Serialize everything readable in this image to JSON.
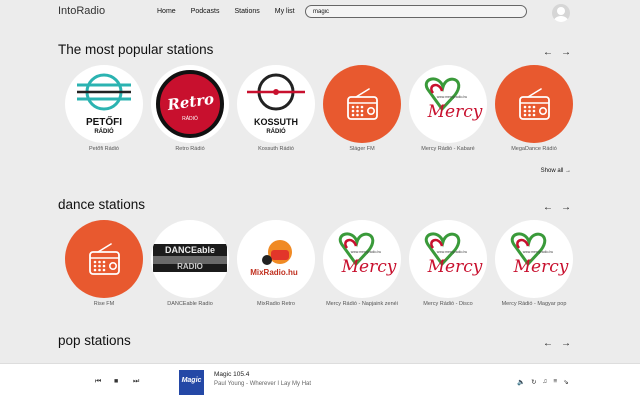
{
  "brand": "IntoRadio",
  "nav": [
    "Home",
    "Podcasts",
    "Stations",
    "My list"
  ],
  "search": {
    "value": "magic"
  },
  "sections": [
    {
      "title": "The most popular stations",
      "show_all": "Show all",
      "stations": [
        {
          "label": "Petőfi Rádió",
          "logo": "petofi"
        },
        {
          "label": "Retro Rádió",
          "logo": "retro"
        },
        {
          "label": "Kossuth Rádió",
          "logo": "kossuth"
        },
        {
          "label": "Sláger FM",
          "logo": "radio"
        },
        {
          "label": "Mercy Rádió - Kabaré",
          "logo": "mercy"
        },
        {
          "label": "MegaDance Rádió",
          "logo": "radio"
        }
      ]
    },
    {
      "title": "dance stations",
      "stations": [
        {
          "label": "Rise FM",
          "logo": "radio"
        },
        {
          "label": "DANCEable Radio",
          "logo": "danceable"
        },
        {
          "label": "MixRadio Retro",
          "logo": "mixradio"
        },
        {
          "label": "Mercy Rádió - Napjaink zenéi",
          "logo": "mercy"
        },
        {
          "label": "Mercy Rádió - Disco",
          "logo": "mercy"
        },
        {
          "label": "Mercy Rádió - Magyar pop",
          "logo": "mercy"
        }
      ]
    },
    {
      "title": "pop stations"
    }
  ],
  "logo_text": {
    "petofi": [
      "PETŐFI",
      "RÁDIÓ"
    ],
    "retro": [
      "Retro",
      "RÁDIÓ"
    ],
    "kossuth": [
      "KOSSUTH",
      "RÁDIÓ"
    ],
    "mercy": [
      "Mercy",
      "www.mercyradio.hu"
    ],
    "danceable": [
      "DANCEable",
      "RADIO"
    ],
    "mixradio": "MixRadio.hu"
  },
  "player": {
    "station": "Magic 105.4",
    "song": "Paul Young - Wherever I Lay My Hat",
    "cover_text": "Magic"
  },
  "colors": {
    "accent": "#e8592f",
    "teal": "#2bb3b1",
    "red": "#c8102e"
  }
}
